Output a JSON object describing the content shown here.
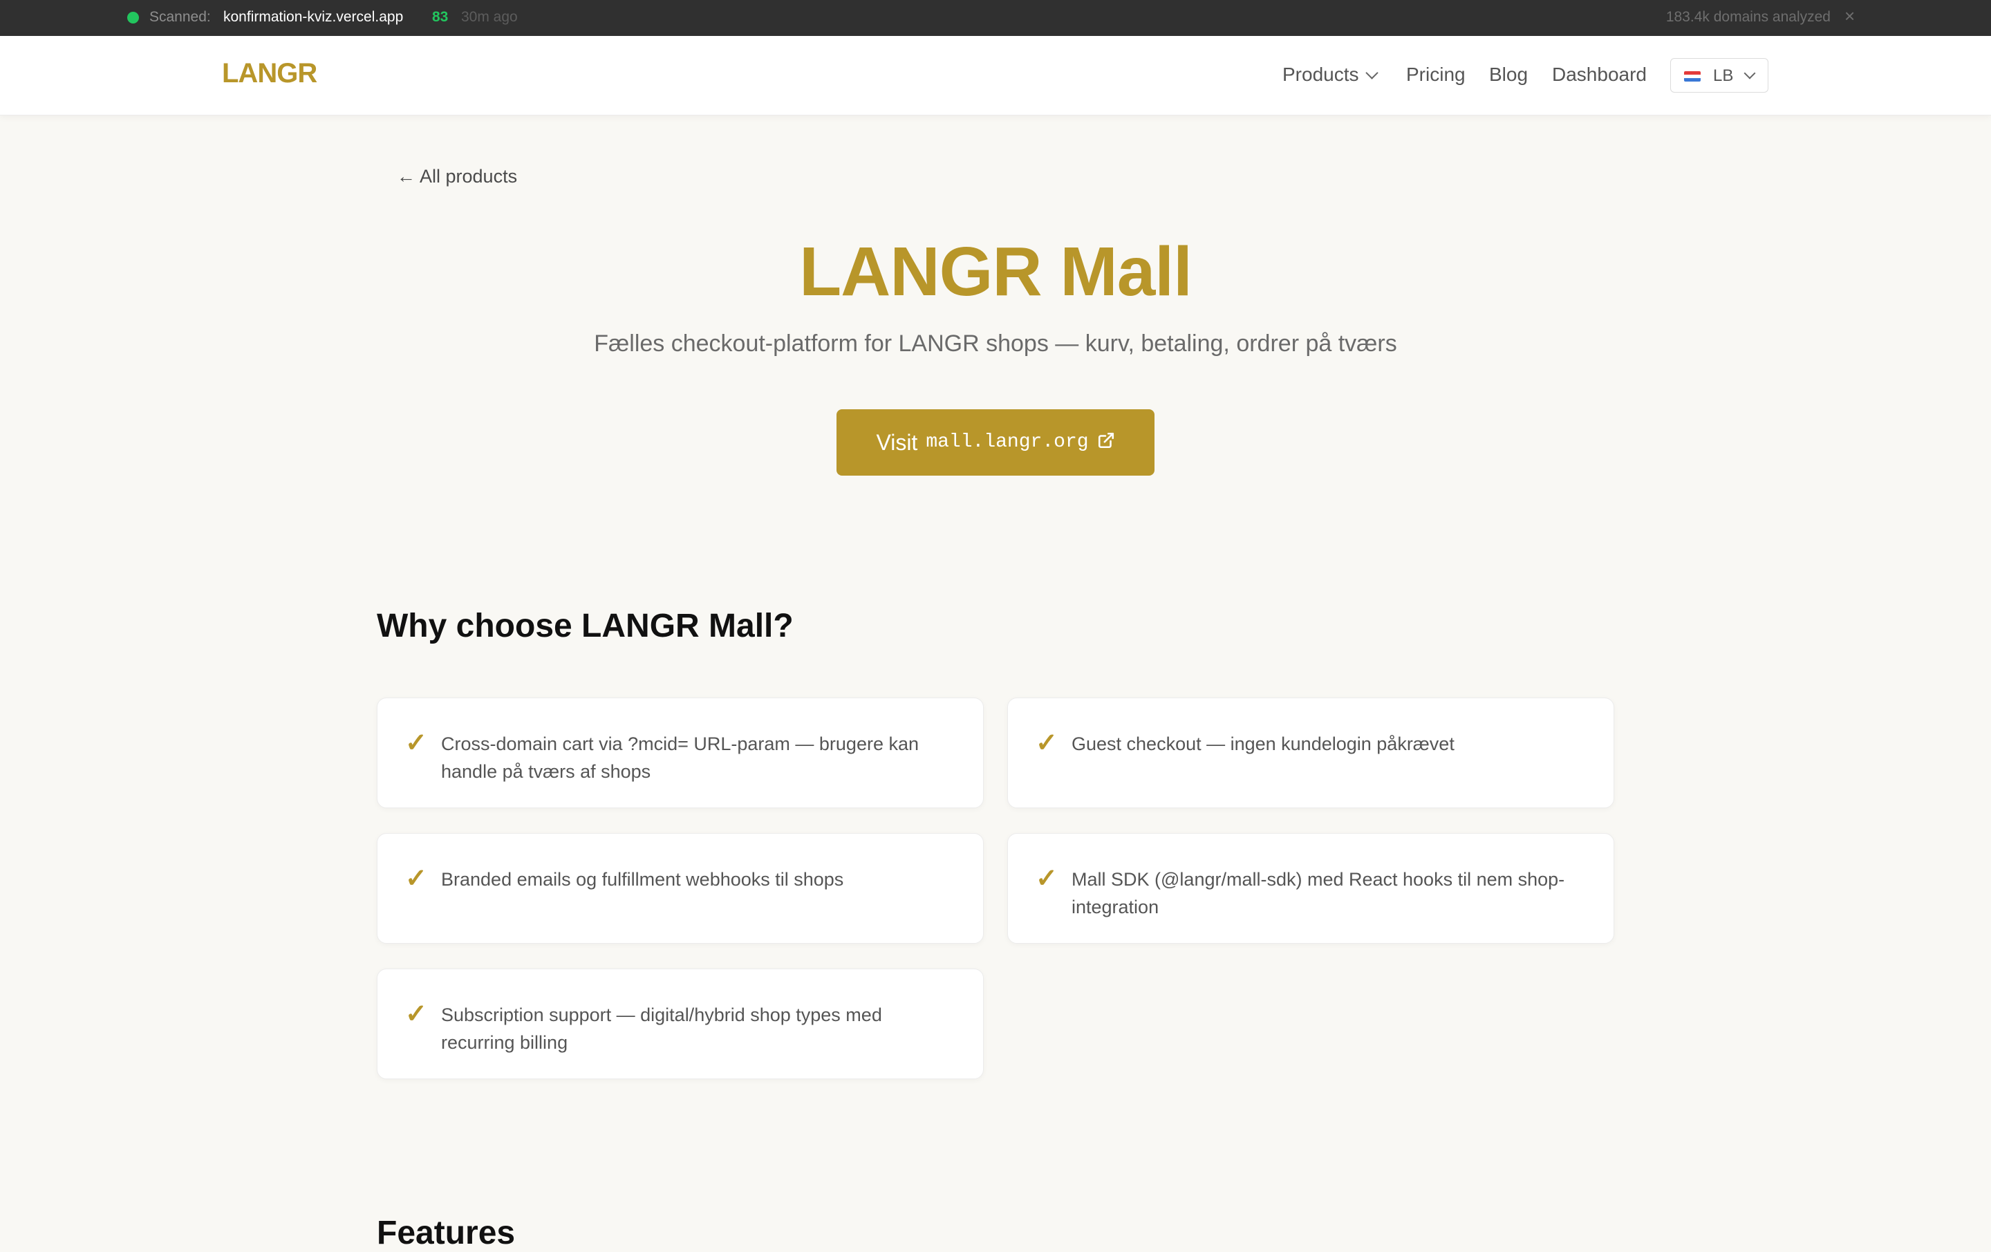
{
  "topbar": {
    "scanned_label": "Scanned:",
    "domain": "konfirmation-kviz.vercel.app",
    "score": "83",
    "time_ago": "30m ago",
    "domains_analyzed": "183.4k domains analyzed",
    "close_glyph": "×"
  },
  "nav": {
    "logo": "LANGR",
    "products": "Products",
    "pricing": "Pricing",
    "blog": "Blog",
    "dashboard": "Dashboard",
    "language": "LB"
  },
  "back_link": "← All products",
  "hero": {
    "title": "LANGR Mall",
    "subtitle": "Fælles checkout-platform for LANGR shops — kurv, betaling, ordrer på tværs",
    "visit_label": "Visit",
    "visit_url": "mall.langr.org"
  },
  "why": {
    "title": "Why choose LANGR Mall?",
    "check_glyph": "✓",
    "items": [
      "Cross-domain cart via ?mcid= URL-param — brugere kan handle på tværs af shops",
      "Guest checkout — ingen kundelogin påkrævet",
      "Branded emails og fulfillment webhooks til shops",
      "Mall SDK (@langr/mall-sdk) med React hooks til nem shop-integration",
      "Subscription support — digital/hybrid shop types med recurring billing"
    ]
  },
  "features": {
    "title": "Features"
  },
  "colors": {
    "accent": "#b8962a",
    "status_green": "#22c55e",
    "topbar_bg": "#303030",
    "page_bg": "#f9f8f4"
  },
  "icons": {
    "status": "status-dot-icon",
    "external": "external-link-icon",
    "flag": "flag-icon",
    "chevron": "chevron-down-icon",
    "check": "check-icon"
  }
}
